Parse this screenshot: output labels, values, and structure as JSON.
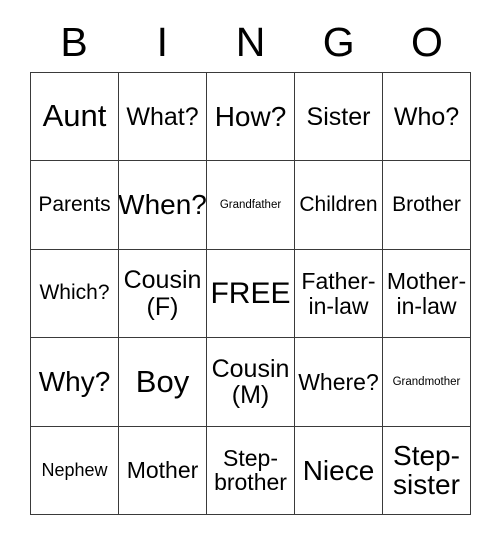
{
  "card": {
    "title": "BINGO",
    "headers": [
      "B",
      "I",
      "N",
      "G",
      "O"
    ],
    "border_color": "#3a3a3a",
    "background_color": "#ffffff",
    "text_color": "#000000",
    "free_space_label": "FREE",
    "rows": [
      [
        {
          "text": "Aunt",
          "size": "fs-xxl"
        },
        {
          "text": "What?",
          "size": "fs-l"
        },
        {
          "text": "How?",
          "size": "fs-xl"
        },
        {
          "text": "Sister",
          "size": "fs-l"
        },
        {
          "text": "Who?",
          "size": "fs-l"
        }
      ],
      [
        {
          "text": "Parents",
          "size": "fs-s"
        },
        {
          "text": "When?",
          "size": "fs-xl"
        },
        {
          "text": "Grandfather",
          "size": "fs-xxs"
        },
        {
          "text": "Children",
          "size": "fs-s"
        },
        {
          "text": "Brother",
          "size": "fs-s"
        }
      ],
      [
        {
          "text": "Which?",
          "size": "fs-s"
        },
        {
          "text": "Cousin\n(F)",
          "size": "fs-l"
        },
        {
          "text": "FREE",
          "size": "fs-free"
        },
        {
          "text": "Father-\nin-law",
          "size": "fs-m"
        },
        {
          "text": "Mother-\nin-law",
          "size": "fs-m"
        }
      ],
      [
        {
          "text": "Why?",
          "size": "fs-xl"
        },
        {
          "text": "Boy",
          "size": "fs-xxl"
        },
        {
          "text": "Cousin\n(M)",
          "size": "fs-l"
        },
        {
          "text": "Where?",
          "size": "fs-m"
        },
        {
          "text": "Grandmother",
          "size": "fs-xxs"
        }
      ],
      [
        {
          "text": "Nephew",
          "size": "fs-xs"
        },
        {
          "text": "Mother",
          "size": "fs-m"
        },
        {
          "text": "Step-\nbrother",
          "size": "fs-m"
        },
        {
          "text": "Niece",
          "size": "fs-xl"
        },
        {
          "text": "Step-\nsister",
          "size": "fs-xl"
        }
      ]
    ]
  }
}
